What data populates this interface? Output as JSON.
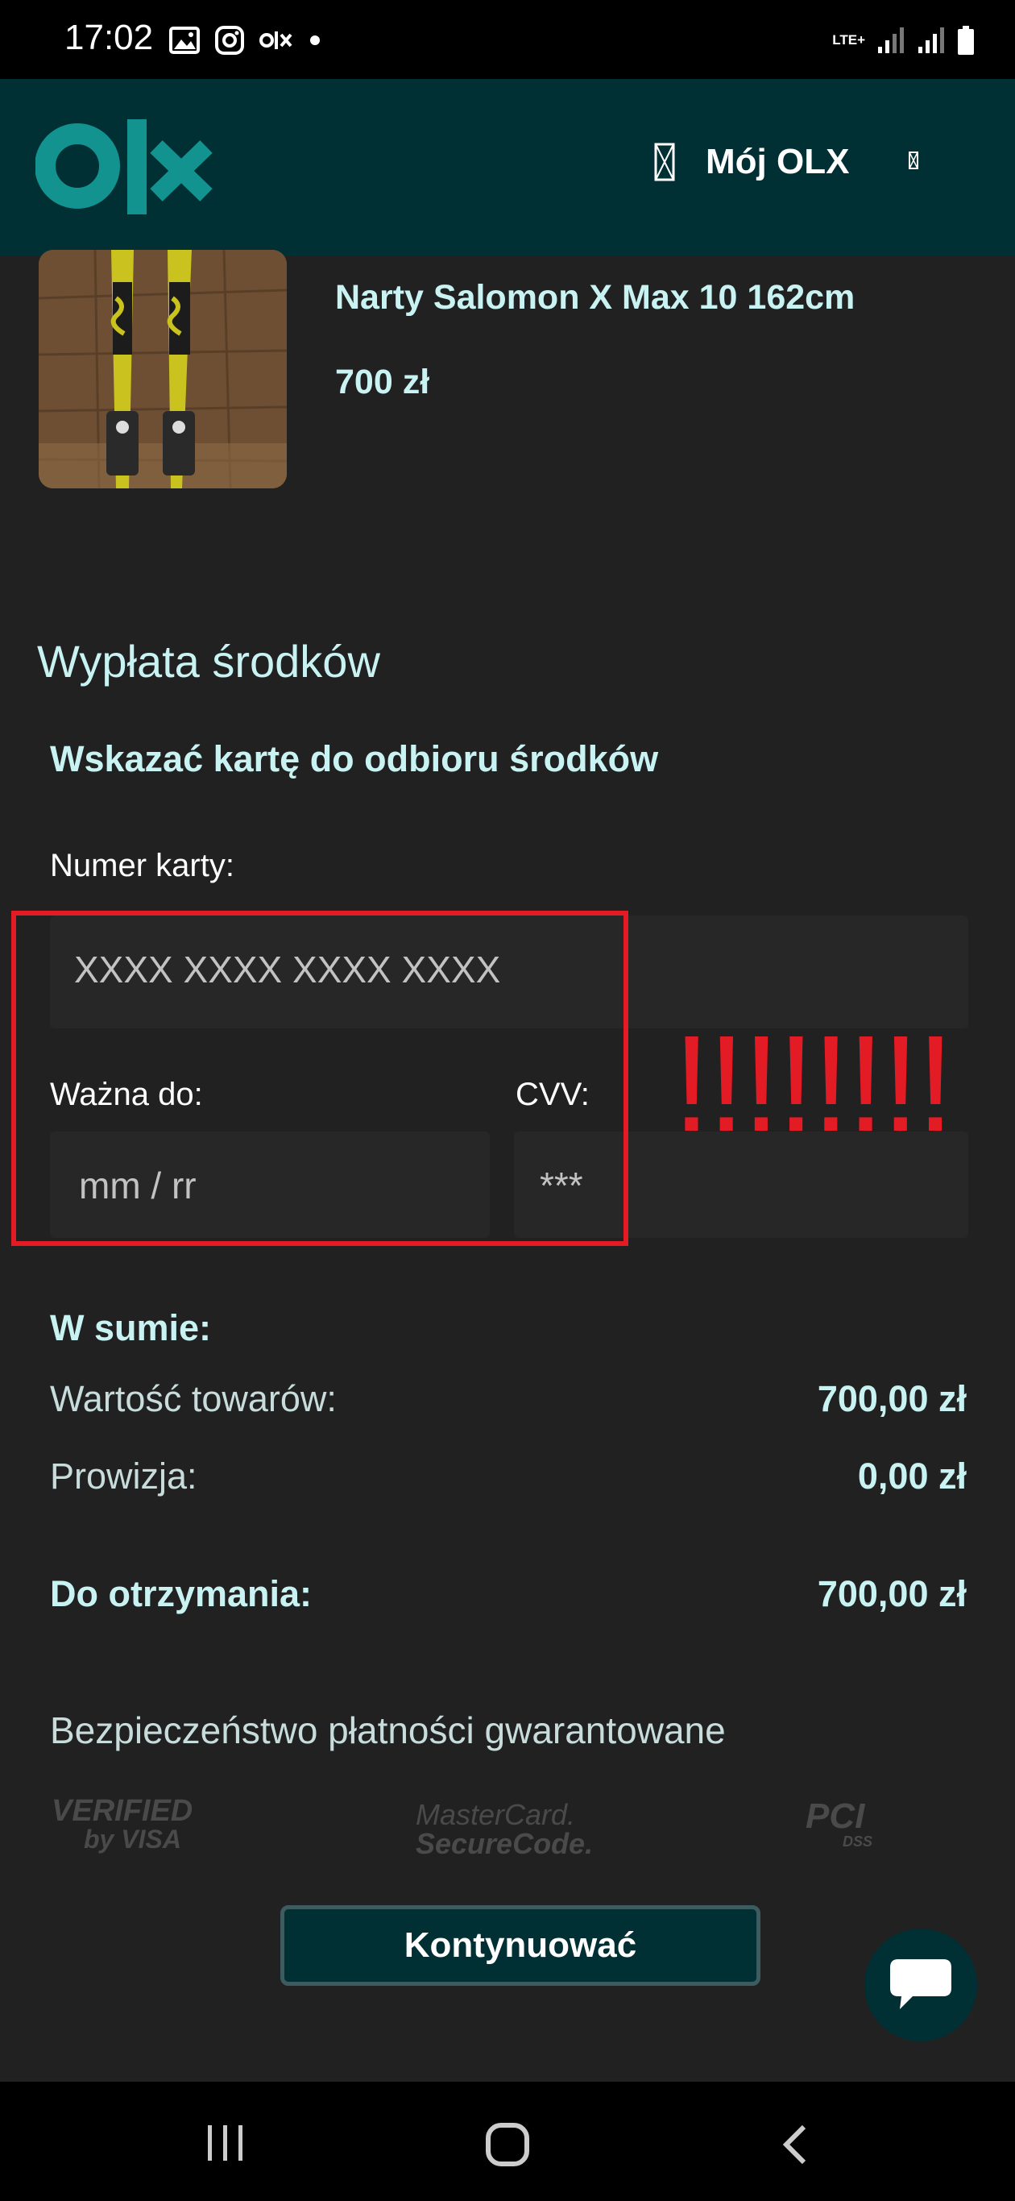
{
  "status_bar": {
    "time": "17:02",
    "left_icons": [
      "gallery-icon",
      "instagram-icon",
      "olx-icon",
      "dot-icon"
    ],
    "network": "LTE+",
    "right_icons": [
      "signal-icon",
      "signal-icon",
      "battery-icon"
    ]
  },
  "header": {
    "logo": "olx-logo",
    "account_icon": "user-icon",
    "account_label": "Mój OLX",
    "menu_icon": "chevron-icon",
    "background": "#002f34",
    "logo_color": "#23e5db"
  },
  "product": {
    "title": "Narty Salomon X Max 10 162cm",
    "price": "700 zł"
  },
  "payout": {
    "section_title": "Wypłata środków",
    "subtitle": "Wskazać kartę do odbioru środków",
    "card_number_label": "Numer karty:",
    "card_number_placeholder": "XXXX XXXX XXXX XXXX",
    "expiry_label": "Ważna do:",
    "expiry_placeholder": "mm / rr",
    "cvv_label": "CVV:",
    "cvv_placeholder": "***",
    "annotation": "!!!!!!!!",
    "annotation_color": "#e21b25"
  },
  "summary": {
    "title": "W sumie:",
    "rows": [
      {
        "label": "Wartość towarów:",
        "value": "700,00 zł"
      },
      {
        "label": "Prowizja:",
        "value": "0,00 zł"
      }
    ],
    "total_label": "Do otrzymania:",
    "total_value": "700,00 zł"
  },
  "security": {
    "text": "Bezpieczeństwo płatności gwarantowane",
    "badges": [
      "VERIFIED",
      "by VISA",
      "MasterCard.",
      "SecureCode.",
      "PCI",
      "DSS"
    ]
  },
  "actions": {
    "continue_label": "Kontynuować",
    "chat_icon": "chat-icon"
  },
  "nav_bar": {
    "icons": [
      "recent-apps-icon",
      "home-icon",
      "back-icon"
    ]
  },
  "colors": {
    "page_bg": "#212121",
    "accent_text": "#c9f3f2"
  }
}
